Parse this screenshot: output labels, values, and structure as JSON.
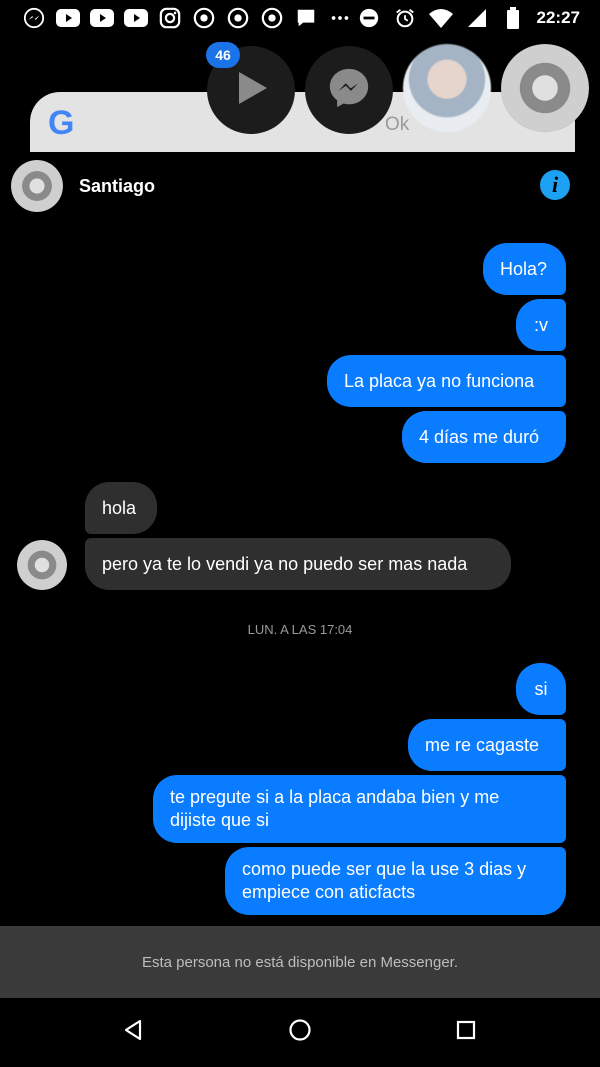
{
  "status_bar": {
    "time": "22:27",
    "left_icons": [
      "messenger-icon",
      "youtube-icon",
      "youtube-icon",
      "youtube-icon",
      "instagram-icon",
      "chrome-icon",
      "chrome-icon",
      "chrome-icon",
      "chat-icon",
      "more-icon"
    ],
    "right_icons": [
      "dnd-icon",
      "alarm-icon",
      "wifi-icon",
      "signal-icon",
      "battery-icon"
    ]
  },
  "overlay": {
    "badge_count": "46",
    "search_hint": "Ok"
  },
  "chat": {
    "contact_name": "Santiago",
    "messages": [
      {
        "dir": "out",
        "text": "Hola?"
      },
      {
        "dir": "out",
        "text": ":v"
      },
      {
        "dir": "out",
        "text": "La placa ya no funciona"
      },
      {
        "dir": "out",
        "text": "4 días me duró"
      },
      {
        "dir": "in",
        "text": "hola"
      },
      {
        "dir": "in",
        "text": "pero ya te lo vendi ya no puedo ser mas nada"
      },
      {
        "dir": "out",
        "text": "si"
      },
      {
        "dir": "out",
        "text": "me re cagaste"
      },
      {
        "dir": "out",
        "text": "te pregute si a la placa andaba bien y me dijiste que si"
      },
      {
        "dir": "out",
        "text": "como puede ser que la use 3 dias y empiece con aticfacts"
      }
    ],
    "timestamp": "LUN. A LAS 17:04",
    "unavailable_notice": "Esta persona no está disponible en Messenger."
  },
  "colors": {
    "outgoing_bubble": "#0a7cff",
    "incoming_bubble": "#2f2f2f",
    "info_icon": "#1da1f2"
  }
}
